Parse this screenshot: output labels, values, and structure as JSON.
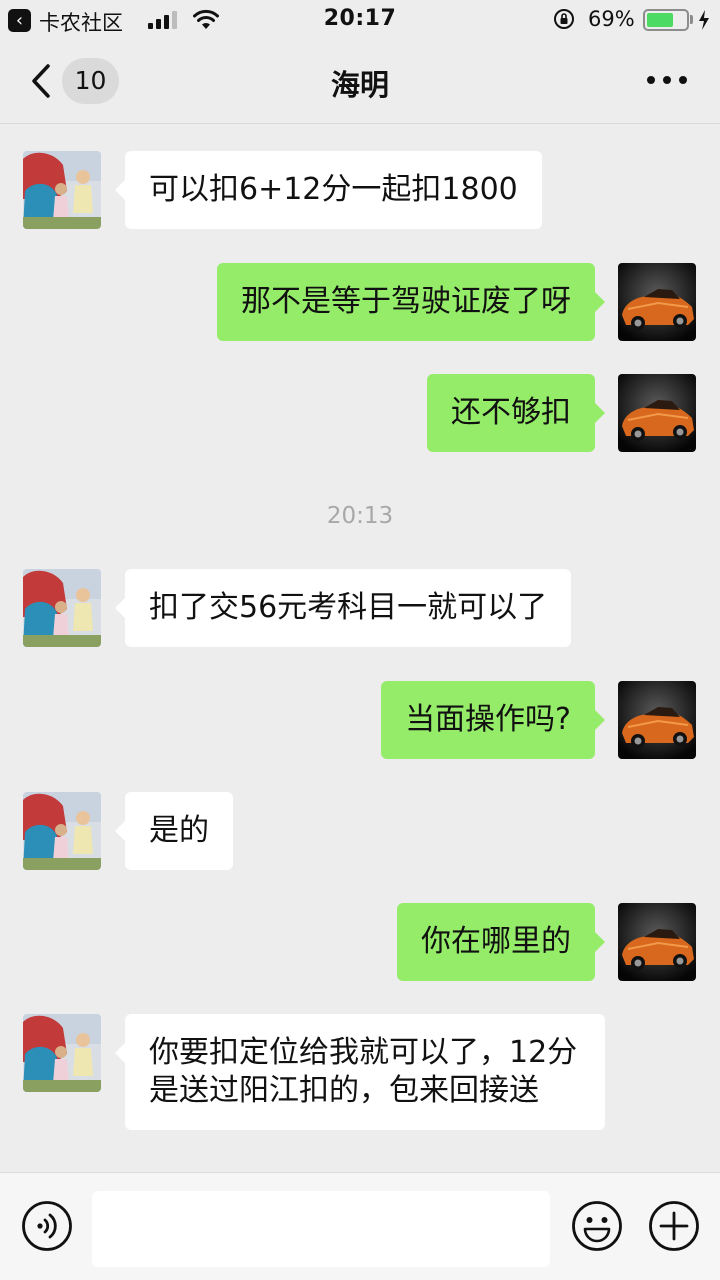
{
  "status_bar": {
    "back_glyph": "‹",
    "carrier": "卡农社区",
    "time": "20:17",
    "battery_percent": "69%",
    "battery_level": 0.69,
    "icons": [
      "back-app-icon",
      "signal-icon",
      "wifi-icon",
      "orientation-lock-icon",
      "battery-icon",
      "charging-icon"
    ]
  },
  "nav": {
    "unread_count": "10",
    "title": "海明",
    "icons": [
      "back-chevron-icon",
      "more-icon"
    ]
  },
  "messages": [
    {
      "side": "in",
      "text": "可以扣6+12分一起扣1800"
    },
    {
      "side": "out",
      "text": "那不是等于驾驶证废了呀"
    },
    {
      "side": "out",
      "text": "还不够扣"
    },
    {
      "side": "time",
      "text": "20:13"
    },
    {
      "side": "in",
      "text": "扣了交56元考科目一就可以了"
    },
    {
      "side": "out",
      "text": "当面操作吗?"
    },
    {
      "side": "in",
      "text": "是的"
    },
    {
      "side": "out",
      "text": "你在哪里的"
    },
    {
      "side": "in",
      "text": "你要扣定位给我就可以了，12分是送过阳江扣的，包来回接送"
    }
  ],
  "input_bar": {
    "placeholder": "",
    "icons": [
      "voice-icon",
      "emoji-icon",
      "plus-icon"
    ]
  },
  "colors": {
    "background": "#ededed",
    "outgoing_bubble": "#95ec69",
    "incoming_bubble": "#ffffff",
    "battery": "#4cd964",
    "timestamp": "#a8a8a8"
  }
}
